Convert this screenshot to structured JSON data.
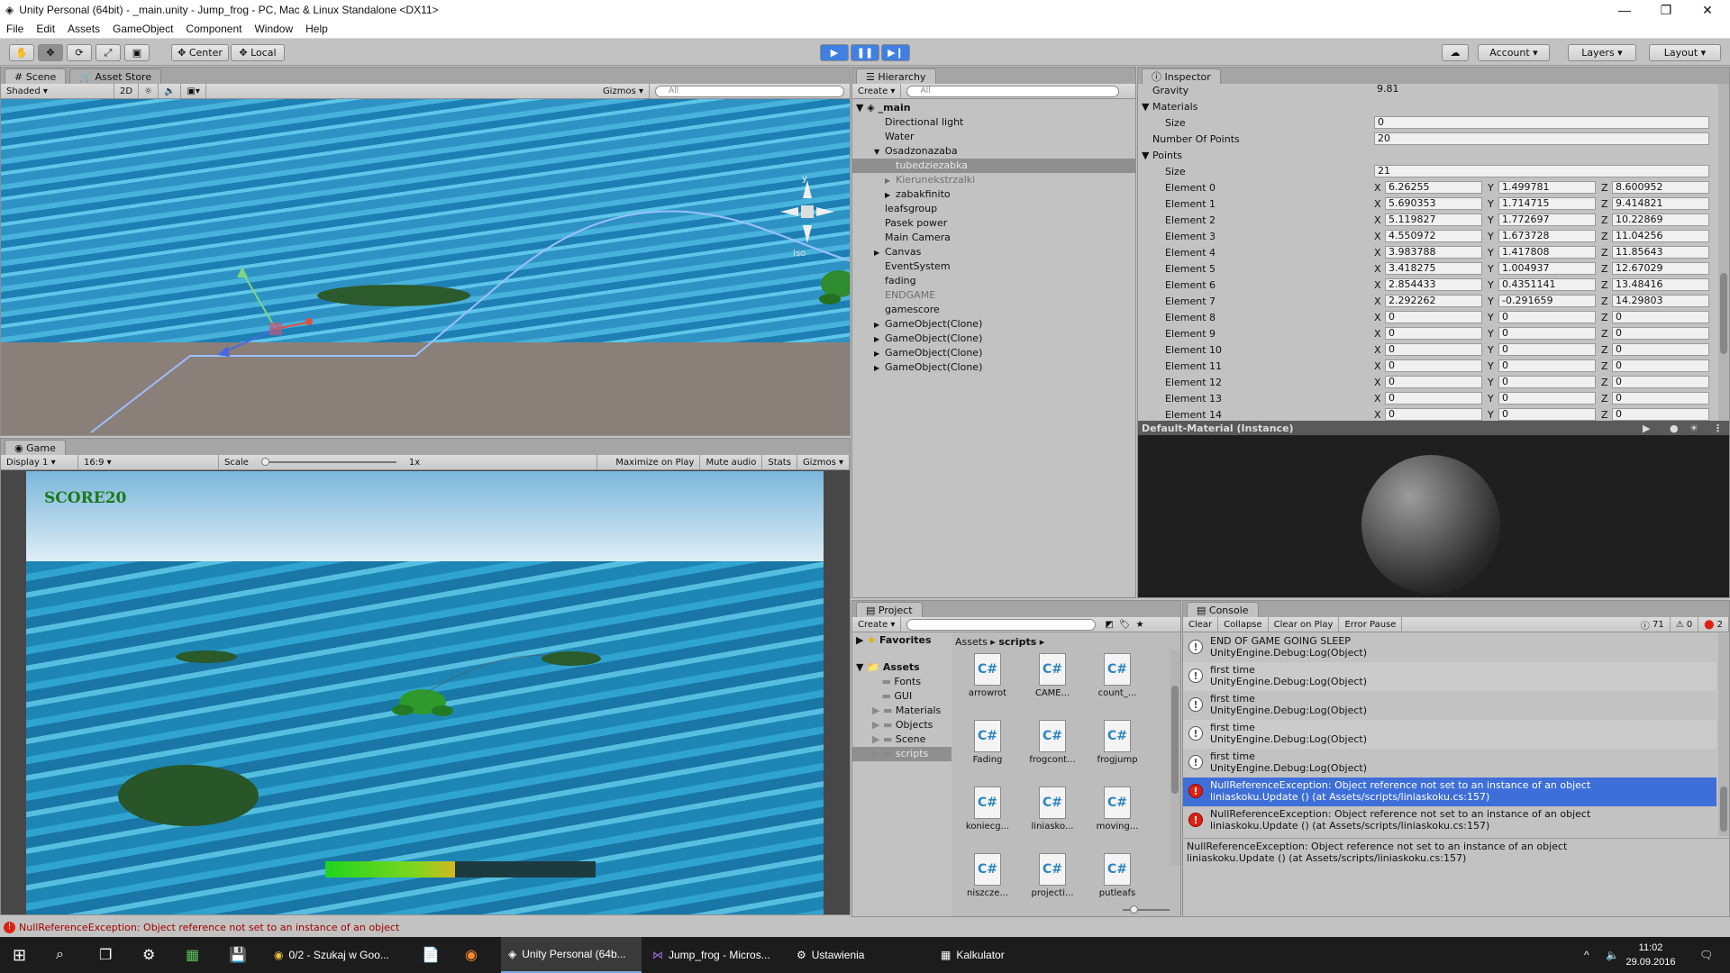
{
  "window": {
    "title": "Unity Personal (64bit) - _main.unity - Jump_frog - PC, Mac & Linux Standalone <DX11>"
  },
  "menu": [
    "File",
    "Edit",
    "Assets",
    "GameObject",
    "Component",
    "Window",
    "Help"
  ],
  "toolbar": {
    "center": "Center",
    "local": "Local",
    "account": "Account",
    "layers": "Layers",
    "layout": "Layout"
  },
  "scene": {
    "tab": "Scene",
    "tab2": "Asset Store",
    "shading": "Shaded",
    "mode2d": "2D",
    "gizmos": "Gizmos",
    "search": "All",
    "iso": "Iso",
    "gizmo_y": "y"
  },
  "game": {
    "tab": "Game",
    "display": "Display 1",
    "aspect": "16:9",
    "scale_label": "Scale",
    "scale_value": "1x",
    "maximize": "Maximize on Play",
    "mute": "Mute audio",
    "stats": "Stats",
    "gizmos": "Gizmos",
    "score": "SCORE20",
    "power": 0.48
  },
  "hierarchy": {
    "tab": "Hierarchy",
    "create": "Create",
    "search": "All",
    "scene": "_main",
    "items": [
      {
        "label": "Directional light",
        "indent": 2,
        "style": ""
      },
      {
        "label": "Water",
        "indent": 2,
        "style": ""
      },
      {
        "label": "Osadzonazaba",
        "indent": 2,
        "style": "",
        "arrow": "▼"
      },
      {
        "label": "tubedziezabka",
        "indent": 3,
        "style": "sel"
      },
      {
        "label": "Kierunekstrzalki",
        "indent": 3,
        "style": "grey",
        "arrow": "▶"
      },
      {
        "label": "zabakfinito",
        "indent": 3,
        "style": "",
        "arrow": "▶"
      },
      {
        "label": "leafsgroup",
        "indent": 2,
        "style": ""
      },
      {
        "label": "Pasek power",
        "indent": 2,
        "style": ""
      },
      {
        "label": "Main Camera",
        "indent": 2,
        "style": ""
      },
      {
        "label": "Canvas",
        "indent": 2,
        "style": "",
        "arrow": "▶"
      },
      {
        "label": "EventSystem",
        "indent": 2,
        "style": ""
      },
      {
        "label": "fading",
        "indent": 2,
        "style": ""
      },
      {
        "label": "ENDGAME",
        "indent": 2,
        "style": "grey"
      },
      {
        "label": "gamescore",
        "indent": 2,
        "style": ""
      },
      {
        "label": "GameObject(Clone)",
        "indent": 2,
        "style": "",
        "arrow": "▶"
      },
      {
        "label": "GameObject(Clone)",
        "indent": 2,
        "style": "",
        "arrow": "▶"
      },
      {
        "label": "GameObject(Clone)",
        "indent": 2,
        "style": "",
        "arrow": "▶"
      },
      {
        "label": "GameObject(Clone)",
        "indent": 2,
        "style": "",
        "arrow": "▶"
      }
    ]
  },
  "inspector": {
    "tab": "Inspector",
    "gravity_label": "Gravity",
    "gravity": "9.81",
    "materials": "Materials",
    "size_label": "Size",
    "materials_size": "0",
    "num_points_label": "Number Of Points",
    "num_points": "20",
    "points": "Points",
    "points_size": "21",
    "elements": [
      {
        "name": "Element 0",
        "x": "6.26255",
        "y": "1.499781",
        "z": "8.600952"
      },
      {
        "name": "Element 1",
        "x": "5.690353",
        "y": "1.714715",
        "z": "9.414821"
      },
      {
        "name": "Element 2",
        "x": "5.119827",
        "y": "1.772697",
        "z": "10.22869"
      },
      {
        "name": "Element 3",
        "x": "4.550972",
        "y": "1.673728",
        "z": "11.04256"
      },
      {
        "name": "Element 4",
        "x": "3.983788",
        "y": "1.417808",
        "z": "11.85643"
      },
      {
        "name": "Element 5",
        "x": "3.418275",
        "y": "1.004937",
        "z": "12.67029"
      },
      {
        "name": "Element 6",
        "x": "2.854433",
        "y": "0.4351141",
        "z": "13.48416"
      },
      {
        "name": "Element 7",
        "x": "2.292262",
        "y": "-0.291659",
        "z": "14.29803"
      },
      {
        "name": "Element 8",
        "x": "0",
        "y": "0",
        "z": "0"
      },
      {
        "name": "Element 9",
        "x": "0",
        "y": "0",
        "z": "0"
      },
      {
        "name": "Element 10",
        "x": "0",
        "y": "0",
        "z": "0"
      },
      {
        "name": "Element 11",
        "x": "0",
        "y": "0",
        "z": "0"
      },
      {
        "name": "Element 12",
        "x": "0",
        "y": "0",
        "z": "0"
      },
      {
        "name": "Element 13",
        "x": "0",
        "y": "0",
        "z": "0"
      },
      {
        "name": "Element 14",
        "x": "0",
        "y": "0",
        "z": "0"
      }
    ],
    "preview_title": "Default-Material (Instance)"
  },
  "project": {
    "tab": "Project",
    "create": "Create",
    "favorites": "Favorites",
    "assets": "Assets",
    "breadcrumb_root": "Assets",
    "breadcrumb_leaf": "scripts",
    "folders": [
      "Fonts",
      "GUI",
      "Materials",
      "Objects",
      "Scene",
      "scripts"
    ],
    "files": [
      "arrowrot",
      "CAME...",
      "count_...",
      "Fading",
      "frogcont...",
      "frogjump",
      "koniecg...",
      "liniasko...",
      "moving...",
      "niszcze...",
      "projecti...",
      "putleafs"
    ]
  },
  "console": {
    "tab": "Console",
    "clear": "Clear",
    "collapse": "Collapse",
    "clear_on_play": "Clear on Play",
    "error_pause": "Error Pause",
    "count_info": "71",
    "count_warn": "0",
    "count_err": "2",
    "rows": [
      {
        "l1": "END OF GAME GOING SLEEP",
        "l2": "UnityEngine.Debug:Log(Object)",
        "kind": "info"
      },
      {
        "l1": "first time",
        "l2": "UnityEngine.Debug:Log(Object)",
        "kind": "info"
      },
      {
        "l1": "first time",
        "l2": "UnityEngine.Debug:Log(Object)",
        "kind": "info"
      },
      {
        "l1": "first time",
        "l2": "UnityEngine.Debug:Log(Object)",
        "kind": "info"
      },
      {
        "l1": "first time",
        "l2": "UnityEngine.Debug:Log(Object)",
        "kind": "info"
      },
      {
        "l1": "NullReferenceException: Object reference not set to an instance of an object",
        "l2": "liniaskoku.Update () (at Assets/scripts/liniaskoku.cs:157)",
        "kind": "err-sel"
      },
      {
        "l1": "NullReferenceException: Object reference not set to an instance of an object",
        "l2": "liniaskoku.Update () (at Assets/scripts/liniaskoku.cs:157)",
        "kind": "err"
      }
    ],
    "detail1": "NullReferenceException: Object reference not set to an instance of an object",
    "detail2": "liniaskoku.Update () (at Assets/scripts/liniaskoku.cs:157)"
  },
  "statusbar": "NullReferenceException: Object reference not set to an instance of an object",
  "taskbar": {
    "items": [
      "0/2 - Szukaj w Goo...",
      "Unity Personal (64b...",
      "Jump_frog - Micros...",
      "Ustawienia",
      "Kalkulator"
    ],
    "time": "11:02",
    "date": "29.09.2016"
  }
}
